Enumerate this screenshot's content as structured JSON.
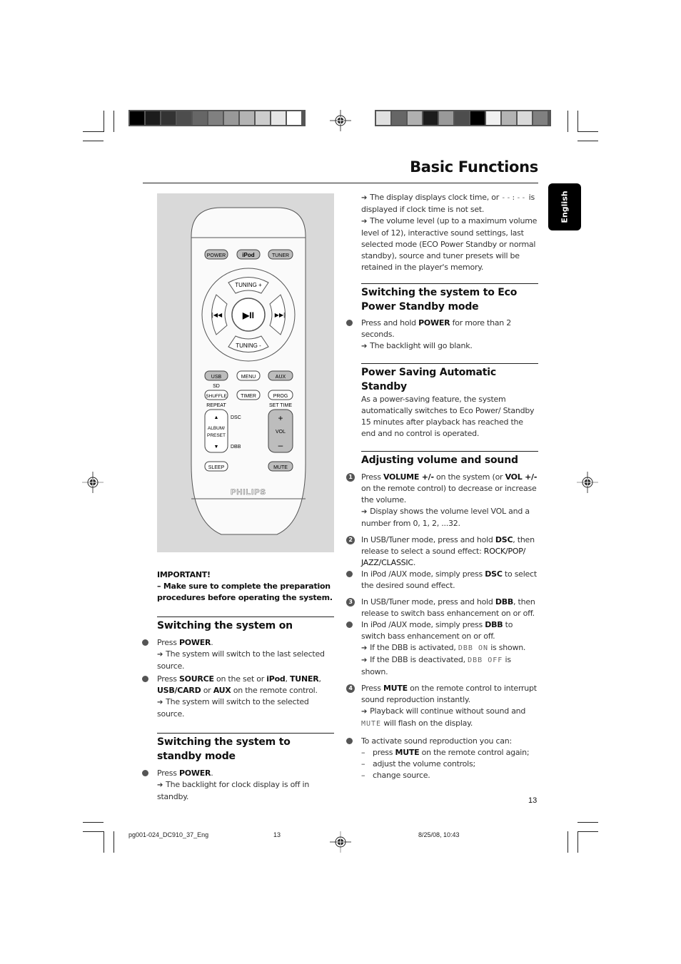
{
  "header": {
    "title": "Basic Functions",
    "language_tab": "English",
    "colorbar_left": [
      "#000000",
      "#1c1c1c",
      "#333333",
      "#4d4d4d",
      "#666666",
      "#808080",
      "#999999",
      "#b3b3b3",
      "#cccccc",
      "#e6e6e6",
      "#ffffff"
    ],
    "colorbar_right": [
      "#e0e0e0",
      "#666666",
      "#b0b0b0",
      "#1c1c1c",
      "#999999",
      "#4d4d4d",
      "#000000",
      "#f0f0f0",
      "#b3b3b3",
      "#d9d9d9",
      "#808080"
    ]
  },
  "remote": {
    "buttons_row1": [
      "POWER",
      "iPod",
      "TUNER"
    ],
    "tuning_plus": "TUNING +",
    "tuning_minus": "TUNING -",
    "prev": "⏮",
    "next": "⏭",
    "play_pause": "▶II",
    "buttons_row2": [
      "USB",
      "MENU",
      "AUX"
    ],
    "sd_label": "SD",
    "buttons_row3": [
      "SHUFFLE",
      "TIMER",
      "PROG"
    ],
    "repeat_label": "REPEAT",
    "set_time_label": "SET TIME",
    "album_preset": [
      "ALBUM/",
      "PRESET"
    ],
    "dsc_label": "DSC",
    "dbb_label": "DBB",
    "vol_label": "VOL",
    "vol_plus": "+",
    "vol_minus": "–",
    "sleep": "SLEEP",
    "mute": "MUTE",
    "brand": "PHILIPS"
  },
  "left": {
    "important_title": "IMPORTANT!",
    "important_text": "–  Make sure to complete the preparation procedures before operating the system.",
    "sections": [
      {
        "heading": "Switching the system on",
        "items": [
          {
            "pre": "Press ",
            "bold": "POWER",
            "post": ".",
            "arrow": "The system will switch to the last selected source."
          },
          {
            "html_parts": [
              "Press ",
              "SOURCE",
              " on the set or ",
              "iPod",
              ", ",
              "TUNER",
              ", ",
              "USB/CARD",
              " or ",
              "AUX",
              " on the remote control."
            ],
            "arrow": "The system will switch to the selected source."
          }
        ]
      },
      {
        "heading": "Switching the system to standby mode",
        "items": [
          {
            "pre": "Press ",
            "bold": "POWER",
            "post": ".",
            "arrow": "The backlight for clock display is off in standby."
          }
        ]
      }
    ]
  },
  "right": {
    "intro_arrow1": "The display displays clock time, or",
    "intro_lcd": "--:--",
    "intro_arrow1_post": "is displayed if clock time is not set.",
    "intro_arrow2": "The volume level (up to a maximum volume level of 12), interactive sound settings, last selected mode (ECO Power  Standby or normal standby), source and tuner presets will be retained in the player's memory.",
    "eco": {
      "heading": "Switching the system to Eco Power Standby mode",
      "pre": "Press and hold ",
      "bold": "POWER",
      "post": " for more than 2 seconds.",
      "arrow": "The backlight will go blank."
    },
    "auto": {
      "heading": "Power Saving Automatic Standby",
      "text": "As a power-saving feature, the system automatically switches to Eco Power/ Standby 15 minutes after playback has reached the end and no control is operated."
    },
    "volume": {
      "heading": "Adjusting volume and sound",
      "step1": {
        "num": "1",
        "p1": "Press ",
        "b1": "VOLUME +/-",
        "p2": " on the system (or ",
        "b2": "VOL +/-",
        "p3": " on the remote control) to decrease or increase the volume.",
        "arrow": "Display shows the volume level VOL and a number from 0, 1, 2, ...32."
      },
      "step2": {
        "num": "2",
        "p1": "In USB/Tuner mode, press and hold ",
        "b1": "DSC",
        "p2": ", then release to select a sound effect: ",
        "effects": "ROCK/POP/ JAZZ/CLASSIC",
        "p3": "."
      },
      "bullet_dsc": {
        "p1": "In iPod /AUX mode, simply press ",
        "b1": "DSC",
        "p2": " to select the desired sound effect."
      },
      "step3": {
        "num": "3",
        "p1": "In USB/Tuner mode, press and hold ",
        "b1": "DBB",
        "p2": ", then release to switch bass enhancement on or off."
      },
      "bullet_dbb": {
        "p1": "In iPod /AUX mode, simply press ",
        "b1": "DBB",
        "p2": " to switch bass enhancement on or off.",
        "arrow_on_pre": "If the DBB is activated, ",
        "lcd_on": "DBB ON",
        "arrow_on_post": " is shown.",
        "arrow_off_pre": "If the DBB is deactivated, ",
        "lcd_off": "DBB OFF",
        "arrow_off_post": " is shown."
      },
      "step4": {
        "num": "4",
        "p1": "Press ",
        "b1": "MUTE",
        "p2": " on the remote control to interrupt sound reproduction instantly.",
        "arrow": "Playback will continue without sound and",
        "lcd": "MUTE",
        "arrow_post": " will flash on the display."
      },
      "bullet_reactivate": {
        "text": "To activate sound reproduction you can:",
        "dash1_pre": "press ",
        "dash1_bold": "MUTE",
        "dash1_post": " on the remote control again;",
        "dash2": "adjust the volume controls;",
        "dash3": "change source."
      }
    }
  },
  "footer": {
    "page_number": "13",
    "file": "pg001-024_DC910_37_Eng",
    "sheet": "13",
    "datetime": "8/25/08, 10:43"
  }
}
